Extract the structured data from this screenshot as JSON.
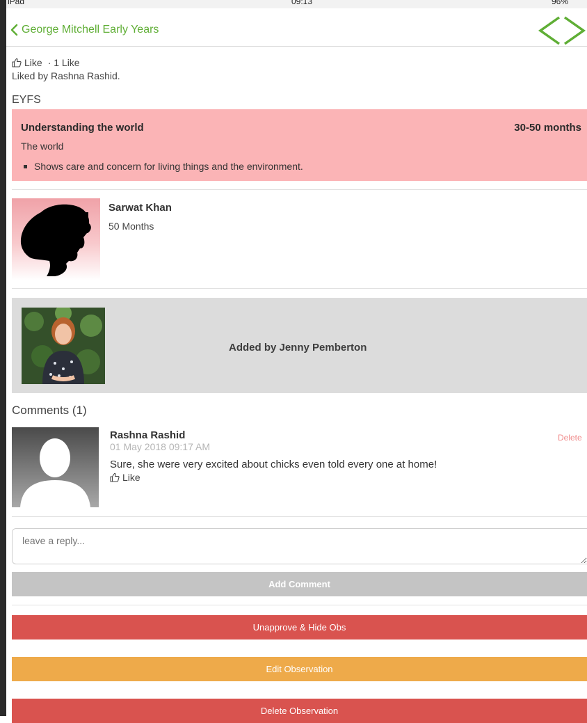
{
  "status_bar": {
    "carrier": "iPad",
    "time": "09:13",
    "battery": "96%"
  },
  "nav": {
    "back_label": "George Mitchell Early Years"
  },
  "likes": {
    "like_label": "Like",
    "count_text": "· 1 Like",
    "liked_by": "Liked by Rashna Rashid."
  },
  "section_heading": "EYFS",
  "eyfs": {
    "area": "Understanding the world",
    "age_band": "30-50 months",
    "aspect": "The world",
    "statement": "Shows care and concern for living things and the environment."
  },
  "child": {
    "name": "Sarwat Khan",
    "age": "50 Months"
  },
  "added_by": "Added by Jenny Pemberton",
  "comments": {
    "heading": "Comments (1)",
    "items": [
      {
        "author": "Rashna Rashid",
        "timestamp": "01 May 2018 09:17 AM",
        "text": "Sure, she were very excited about chicks even told every one at home!",
        "like_label": "Like",
        "delete_label": "Delete"
      }
    ]
  },
  "reply": {
    "placeholder": "leave a reply..."
  },
  "buttons": {
    "add_comment": "Add Comment",
    "unapprove": "Unapprove & Hide Obs",
    "edit": "Edit Observation",
    "delete": "Delete Observation"
  },
  "colors": {
    "accent_green": "#5fae35",
    "eyfs_pink": "#fbb4b6",
    "danger_red": "#d9534f",
    "warning_orange": "#eeaa4a",
    "disabled_grey": "#c4c4c4"
  }
}
